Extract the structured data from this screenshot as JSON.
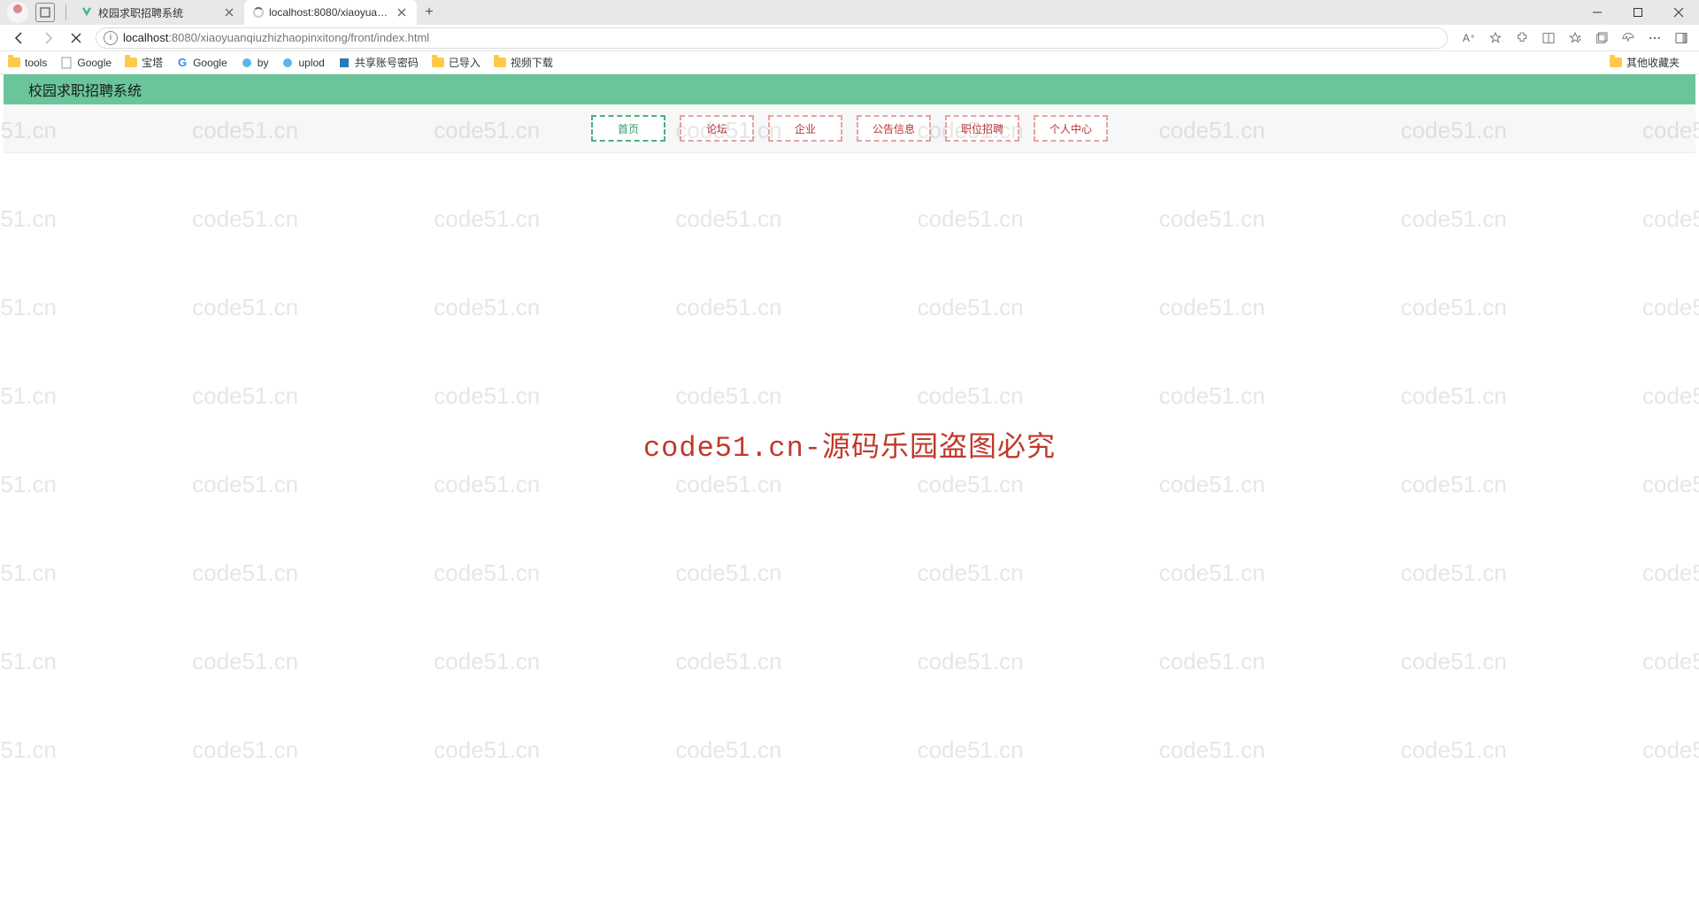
{
  "browser": {
    "tabs": [
      {
        "title": "校园求职招聘系统",
        "active": false
      },
      {
        "title": "localhost:8080/xiaoyuanqiuzhizh",
        "active": true
      }
    ],
    "url_host": "localhost",
    "url_path": ":8080/xiaoyuanqiuzhizhaopinxitong/front/index.html",
    "actions": {
      "aa_label": "A⁺"
    }
  },
  "bookmarks": {
    "items": [
      {
        "label": "tools",
        "type": "folder"
      },
      {
        "label": "Google",
        "type": "page-g"
      },
      {
        "label": "宝塔",
        "type": "folder"
      },
      {
        "label": "Google",
        "type": "page-g"
      },
      {
        "label": "by",
        "type": "page-blue"
      },
      {
        "label": "uplod",
        "type": "page-blue"
      },
      {
        "label": "共享账号密码",
        "type": "page-az"
      },
      {
        "label": "已导入",
        "type": "folder"
      },
      {
        "label": "视频下载",
        "type": "folder"
      }
    ],
    "overflow": "其他收藏夹"
  },
  "page": {
    "title": "校园求职招聘系统",
    "menu": [
      {
        "label": "首页",
        "active": true
      },
      {
        "label": "论坛",
        "active": false
      },
      {
        "label": "企业",
        "active": false
      },
      {
        "label": "公告信息",
        "active": false
      },
      {
        "label": "职位招聘",
        "active": false
      },
      {
        "label": "个人中心",
        "active": false
      }
    ]
  },
  "watermark": {
    "text": "code51.cn",
    "center": "code51.cn-源码乐园盗图必究"
  }
}
